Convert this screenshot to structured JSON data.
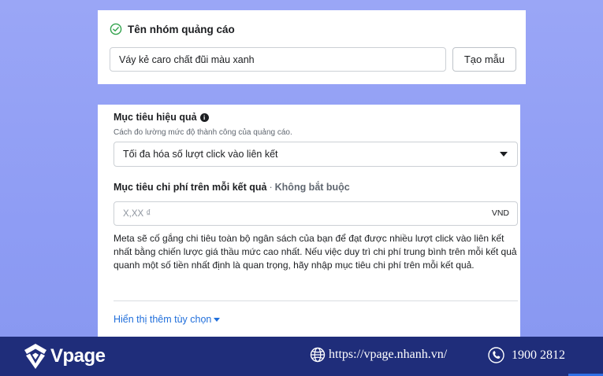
{
  "ad_group": {
    "title": "Tên nhóm quảng cáo",
    "name_value": "Váy kẻ caro chất đũi màu xanh",
    "template_button_label": "Tạo mẫu",
    "status_icon": "check-circle-icon"
  },
  "performance_goal": {
    "title": "Mục tiêu hiệu quả",
    "description": "Cách đo lường mức độ thành công của quảng cáo.",
    "selected_value": "Tối đa hóa số lượt click vào liên kết",
    "cost_goal_title": "Mục tiêu chi phí trên mỗi kết quả",
    "cost_goal_separator": "·",
    "cost_goal_optional": "Không bắt buộc",
    "cost_placeholder": "X,XX ₫",
    "currency": "VND",
    "helper_text": "Meta sẽ cố gắng chi tiêu toàn bộ ngân sách của bạn để đạt được nhiều lượt click vào liên kết nhất bằng chiến lược giá thầu mức cao nhất. Nếu việc duy trì chi phí trung bình trên mỗi kết quả quanh một số tiền nhất định là quan trọng, hãy nhập mục tiêu chi phí trên mỗi kết quả.",
    "more_options_label": "Hiển thị thêm tùy chọn"
  },
  "footer": {
    "brand": "Vpage",
    "website": "https://vpage.nhanh.vn/",
    "phone": "1900 2812"
  },
  "colors": {
    "background": "#9aa6f6",
    "footer": "#1f2d7a",
    "link": "#216fdb",
    "success": "#31a24c"
  }
}
